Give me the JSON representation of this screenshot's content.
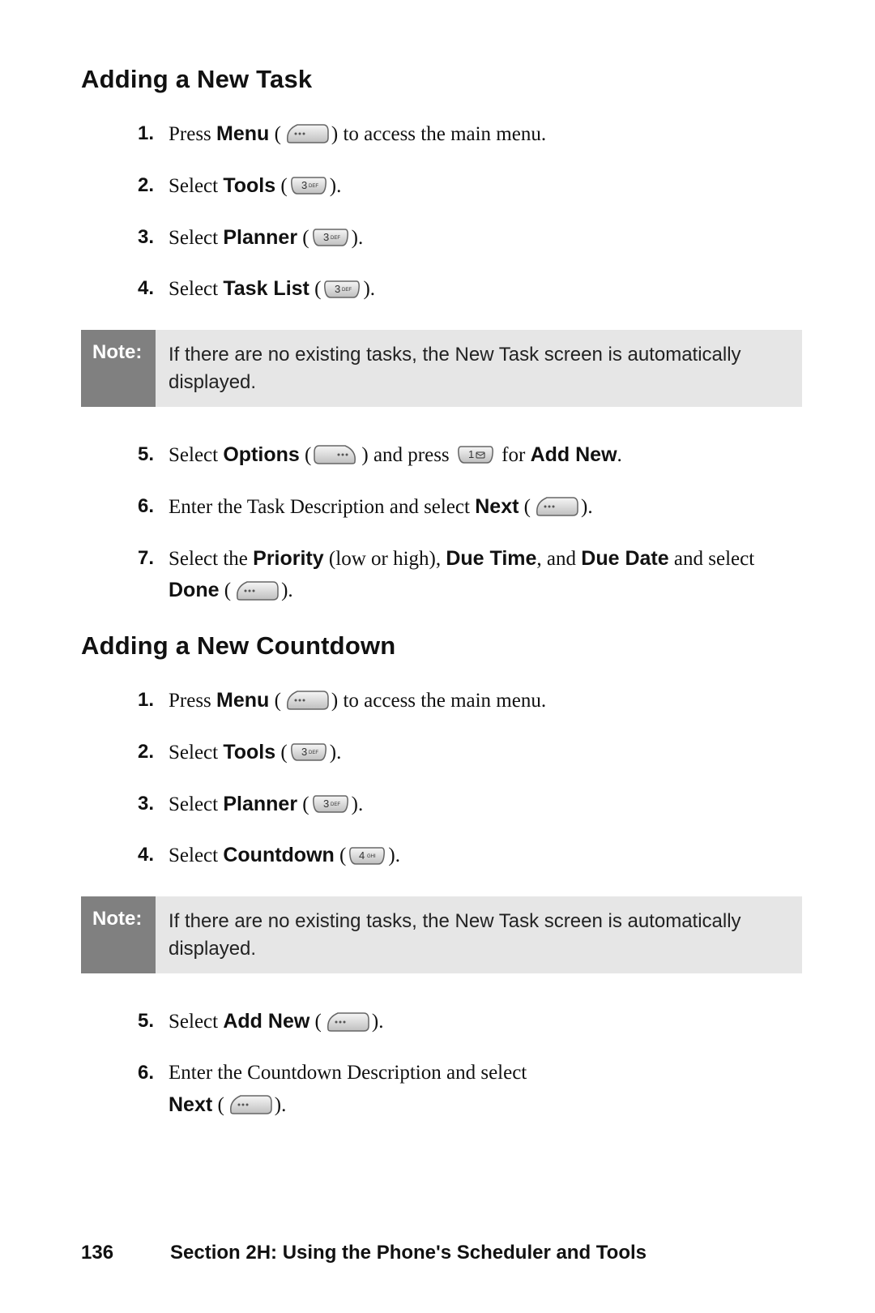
{
  "section1": {
    "heading": "Adding a New Task",
    "steps": [
      {
        "num": "1.",
        "pre": "Press ",
        "bold1": "Menu",
        "post": " to access the main menu.",
        "key": "softkey-left"
      },
      {
        "num": "2.",
        "pre": "Select ",
        "bold1": "Tools",
        "post": ".",
        "key": "key-3"
      },
      {
        "num": "3.",
        "pre": "Select ",
        "bold1": "Planner",
        "post": ".",
        "key": "key-3"
      },
      {
        "num": "4.",
        "pre": "Select ",
        "bold1": "Task List",
        "post": ".",
        "key": "key-3"
      }
    ],
    "note_label": "Note:",
    "note_body": "If there are no existing tasks, the New Task screen is automatically displayed.",
    "steps2": {
      "s5": {
        "num": "5.",
        "t1": "Select ",
        "b1": "Options",
        "t2": " and press ",
        "t3": " for ",
        "b2": "Add New",
        "t4": "."
      },
      "s6": {
        "num": "6.",
        "t1": "Enter the Task Description and select ",
        "b1": "Next",
        "t2": "."
      },
      "s7": {
        "num": "7.",
        "t1": "Select the ",
        "b1": "Priority",
        "t2": " (low or high), ",
        "b2": "Due Time",
        "t3": ", and ",
        "b3": "Due Date",
        "t4": " and select ",
        "b4": "Done",
        "t5": "."
      }
    }
  },
  "section2": {
    "heading": "Adding a New Countdown",
    "steps": [
      {
        "num": "1.",
        "pre": "Press ",
        "bold1": "Menu",
        "post": " to access the main menu.",
        "key": "softkey-left"
      },
      {
        "num": "2.",
        "pre": "Select ",
        "bold1": "Tools",
        "post": ".",
        "key": "key-3"
      },
      {
        "num": "3.",
        "pre": "Select ",
        "bold1": "Planner",
        "post": ".",
        "key": "key-3"
      },
      {
        "num": "4.",
        "pre": "Select ",
        "bold1": "Countdown",
        "post": ".",
        "key": "key-4"
      }
    ],
    "note_label": "Note:",
    "note_body": "If there are no existing tasks, the New Task screen is automatically displayed.",
    "steps2": {
      "s5": {
        "num": "5.",
        "t1": "Select ",
        "b1": "Add New",
        "t2": "."
      },
      "s6": {
        "num": "6.",
        "t1": "Enter the Countdown Description and select ",
        "b1": "Next",
        "t2": "."
      }
    }
  },
  "footer": {
    "page_number": "136",
    "section_label": "Section 2H: Using the Phone's Scheduler and Tools"
  },
  "keys": {
    "key3_num": "3",
    "key3_letters": "DEF",
    "key4_num": "4",
    "key4_letters": "GHI",
    "key1_num": "1"
  }
}
